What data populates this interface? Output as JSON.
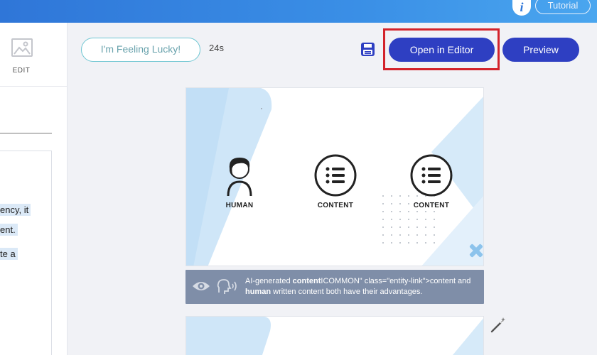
{
  "topbar": {
    "info_label": "i",
    "tutorial_label": "Tutorial"
  },
  "left_panel": {
    "edit_label": "EDIT",
    "snippets": [
      "ency, it",
      "ent.",
      "te a"
    ]
  },
  "toolbar": {
    "lucky_label": "I'm Feeling Lucky!",
    "timer": "24s",
    "editor_label": "Open in Editor",
    "preview_label": "Preview"
  },
  "slide": {
    "items": [
      {
        "label": "HUMAN",
        "icon": "person-icon"
      },
      {
        "label": "CONTENT",
        "icon": "list-icon"
      },
      {
        "label": "CONTENT",
        "icon": "list-icon"
      }
    ]
  },
  "caption": {
    "pre": "AI-generated ",
    "bold1": "content",
    "mid": "ICOMMON\" class=\"entity-link\">content and",
    "bold2": "human",
    "post": " written content both have their advantages."
  },
  "colors": {
    "topbar": "#3a8fe6",
    "primary_button": "#2e3fc2",
    "highlight": "#d3232b",
    "lucky_border": "#6ec6d2",
    "slide_accent": "#cfe6f8",
    "caption_bg": "#7f8ea8"
  }
}
